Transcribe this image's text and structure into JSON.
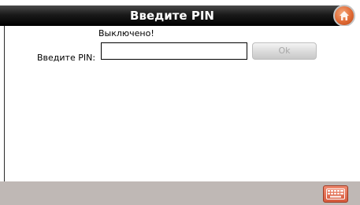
{
  "window": {
    "title": "Введите PIN"
  },
  "form": {
    "status": "Выключено!",
    "pin_label": "Введите PIN:",
    "pin_value": "",
    "ok_label": "Ok"
  },
  "icons": {
    "home": "home-icon",
    "keyboard": "keyboard-icon"
  },
  "colors": {
    "title_bar": "#000000",
    "home_button": "#e06a35",
    "bottom_bar": "#bfb8b5",
    "keyboard_button": "#d65a3d",
    "ok_disabled_text": "#a8a8a8"
  }
}
